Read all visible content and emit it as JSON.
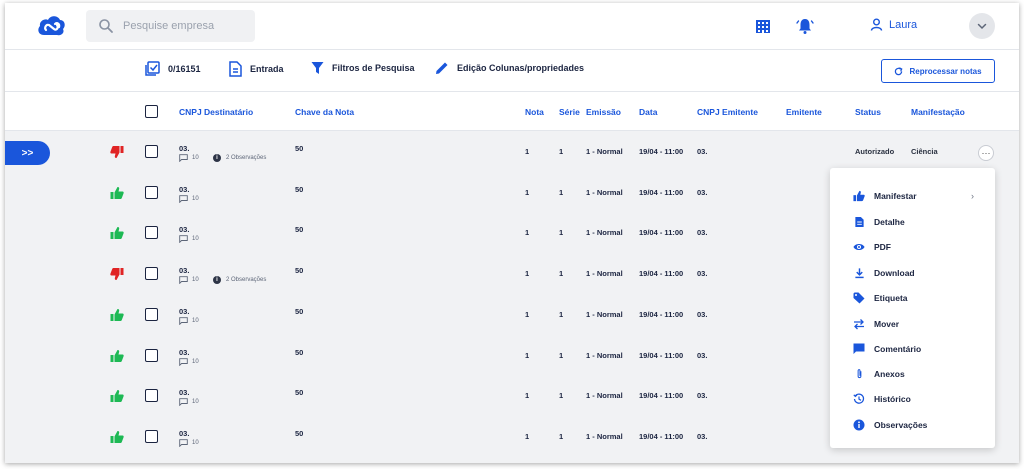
{
  "header": {
    "search_placeholder": "Pesquise empresa",
    "user_name": "Laura",
    "accent": "#1a56db"
  },
  "toolbar": {
    "selection_count": "0/16151",
    "entrada_label": "Entrada",
    "filters_label": "Filtros de Pesquisa",
    "columns_label": "Edição Colunas/propriedades",
    "reprocess_label": "Reprocessar notas"
  },
  "table": {
    "columns": [
      "CNPJ Destinatário",
      "Chave da Nota",
      "Nota",
      "Série",
      "Emissão",
      "Data",
      "CNPJ Emitente",
      "Emitente",
      "Status",
      "Manifestação"
    ],
    "rows": [
      {
        "thumb": "down",
        "cnpj": "03.",
        "comments": "10",
        "observations": "2 Observações",
        "chave": "50",
        "nota": "1",
        "serie": "1",
        "emissao": "1 - Normal",
        "data": "19/04 - 11:00",
        "cnpj_emitente": "03.",
        "status": "Autorizado",
        "manifestacao": "Ciência"
      },
      {
        "thumb": "up",
        "cnpj": "03.",
        "comments": "10",
        "observations": "",
        "chave": "50",
        "nota": "1",
        "serie": "1",
        "emissao": "1 - Normal",
        "data": "19/04 - 11:00",
        "cnpj_emitente": "03.",
        "status": "",
        "manifestacao": ""
      },
      {
        "thumb": "up",
        "cnpj": "03.",
        "comments": "10",
        "observations": "",
        "chave": "50",
        "nota": "1",
        "serie": "1",
        "emissao": "1 - Normal",
        "data": "19/04 - 11:00",
        "cnpj_emitente": "03.",
        "status": "",
        "manifestacao": ""
      },
      {
        "thumb": "down",
        "cnpj": "03.",
        "comments": "10",
        "observations": "2 Observações",
        "chave": "50",
        "nota": "1",
        "serie": "1",
        "emissao": "1 - Normal",
        "data": "19/04 - 11:00",
        "cnpj_emitente": "03.",
        "status": "",
        "manifestacao": ""
      },
      {
        "thumb": "up",
        "cnpj": "03.",
        "comments": "10",
        "observations": "",
        "chave": "50",
        "nota": "1",
        "serie": "1",
        "emissao": "1 - Normal",
        "data": "19/04 - 11:00",
        "cnpj_emitente": "03.",
        "status": "",
        "manifestacao": ""
      },
      {
        "thumb": "up",
        "cnpj": "03.",
        "comments": "10",
        "observations": "",
        "chave": "50",
        "nota": "1",
        "serie": "1",
        "emissao": "1 - Normal",
        "data": "19/04 - 11:00",
        "cnpj_emitente": "03.",
        "status": "",
        "manifestacao": ""
      },
      {
        "thumb": "up",
        "cnpj": "03.",
        "comments": "10",
        "observations": "",
        "chave": "50",
        "nota": "1",
        "serie": "1",
        "emissao": "1 - Normal",
        "data": "19/04 - 11:00",
        "cnpj_emitente": "03.",
        "status": "",
        "manifestacao": ""
      },
      {
        "thumb": "up",
        "cnpj": "03.",
        "comments": "10",
        "observations": "",
        "chave": "50",
        "nota": "1",
        "serie": "1",
        "emissao": "1 - Normal",
        "data": "19/04 - 11:00",
        "cnpj_emitente": "03.",
        "status": "",
        "manifestacao": ""
      }
    ],
    "expand_label": ">>",
    "more_label": "···",
    "thumb_colors": {
      "up": "#1db954",
      "down": "#e02424"
    }
  },
  "context_menu": {
    "items": [
      {
        "label": "Manifestar",
        "icon": "thumb-up-icon",
        "submenu": true
      },
      {
        "label": "Detalhe",
        "icon": "document-icon"
      },
      {
        "label": "PDF",
        "icon": "eye-icon"
      },
      {
        "label": "Download",
        "icon": "download-icon"
      },
      {
        "label": "Etiqueta",
        "icon": "tag-icon"
      },
      {
        "label": "Mover",
        "icon": "swap-icon"
      },
      {
        "label": "Comentário",
        "icon": "comment-icon"
      },
      {
        "label": "Anexos",
        "icon": "paperclip-icon"
      },
      {
        "label": "Histórico",
        "icon": "history-icon"
      },
      {
        "label": "Observações",
        "icon": "info-icon"
      }
    ],
    "chevron": "›"
  }
}
